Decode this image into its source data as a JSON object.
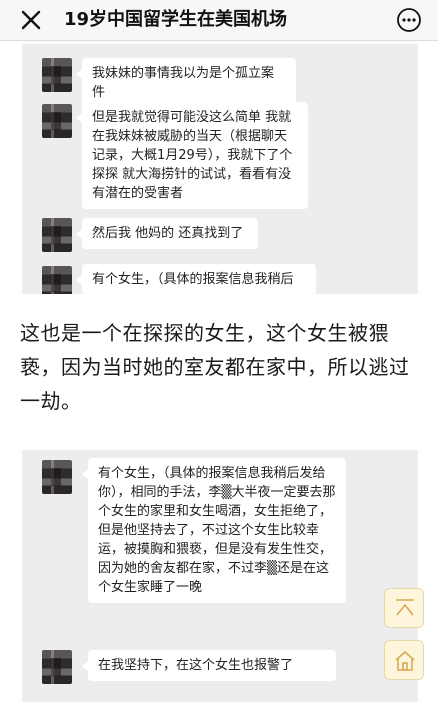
{
  "header": {
    "title": "19岁中国留学生在美国机场",
    "close_icon": "close-icon",
    "more_icon": "more-icon"
  },
  "chat1": {
    "messages": [
      "我妹妹的事情我以为是个孤立案件",
      "但是我就觉得可能没这么简单 我就在我妹妹被威胁的当天（根据聊天记录，大概1月29号），我就下了个探探 就大海捞针的试试，看看有没有潜在的受害者",
      "然后我 他妈的 还真找到了",
      "有个女生，（具体的报案信息我稍后"
    ]
  },
  "article": {
    "paragraph": "这也是一个在探探的女生，这个女生被猥亵，因为当时她的室友都在家中，所以逃过一劫。"
  },
  "chat2": {
    "messages": [
      "有个女生，（具体的报案信息我稍后发给你），相同的手法，李▒大半夜一定要去那个女生的家里和女生喝酒，女生拒绝了，但是他坚持去了，不过这个女生比较幸运，被摸胸和猥亵，但是没有发生性交，因为她的舍友都在家，不过李▒还是在这个女生家睡了一晚",
      "在我坚持下，在这个女生也报警了"
    ]
  },
  "floating": {
    "back_to_top_icon": "chevron-up-icon",
    "home_icon": "home-icon",
    "accent": "#e2b96a"
  }
}
